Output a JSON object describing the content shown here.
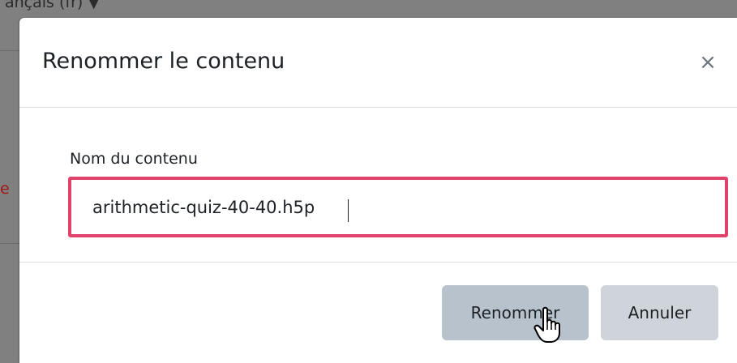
{
  "background": {
    "language_selector": "ançais (fr) ▼",
    "edge_text": "e"
  },
  "dialog": {
    "title": "Renommer le contenu",
    "close_icon": "close-icon",
    "close_glyph": "×",
    "field": {
      "label": "Nom du contenu",
      "value": "arithmetic-quiz-40-40.h5p"
    },
    "buttons": {
      "rename": "Renommer",
      "cancel": "Annuler"
    }
  },
  "colors": {
    "input_focus_border": "#e0426b",
    "rename_button_bg": "#b7c2cc",
    "cancel_button_bg": "#ced4da",
    "overlay": "#808080"
  }
}
